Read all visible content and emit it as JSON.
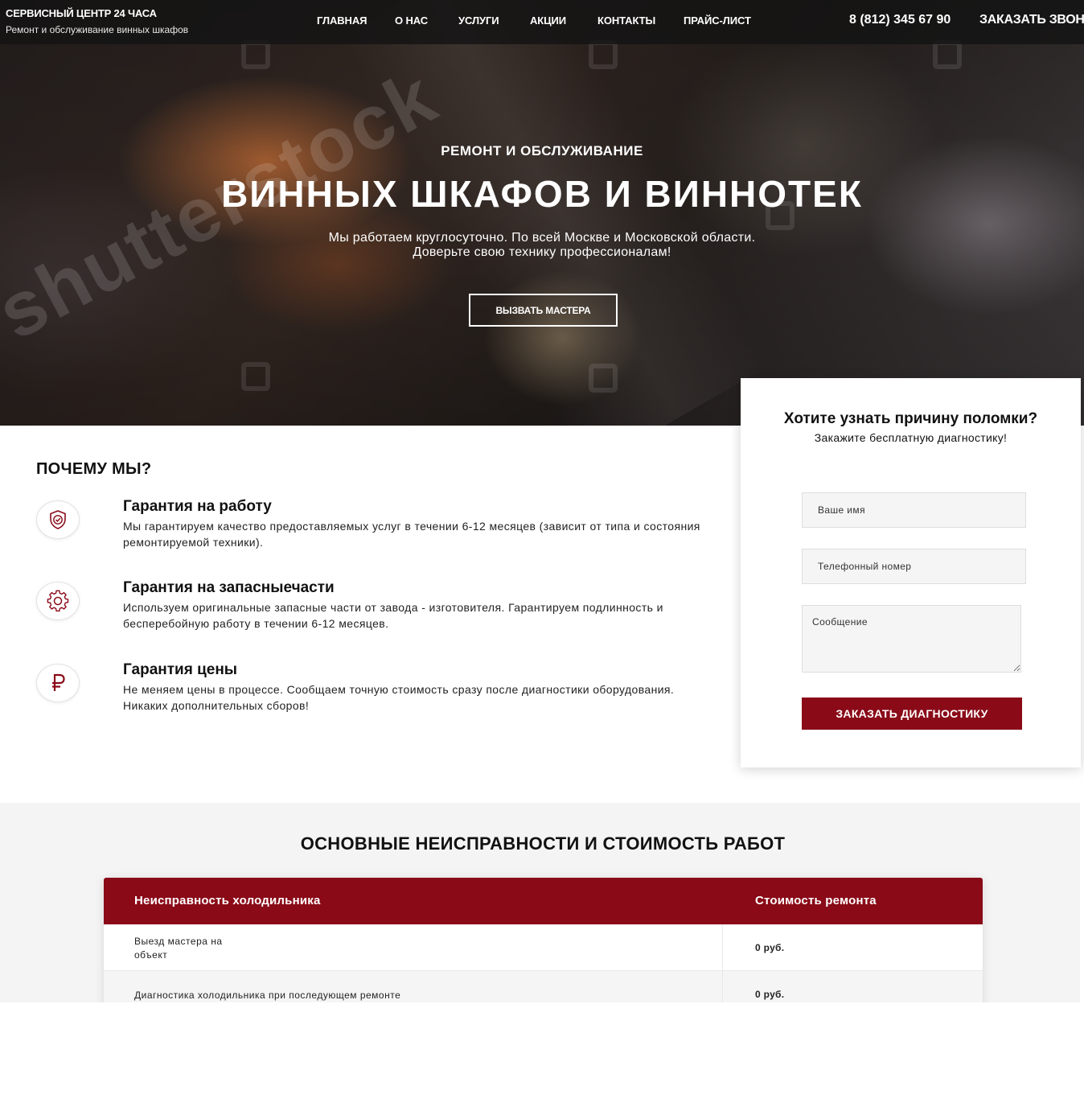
{
  "header": {
    "brand_title": "СЕРВИСНЫЙ ЦЕНТР 24 ЧАСА",
    "brand_subtitle": "Ремонт и обслуживание винных шкафов",
    "nav": [
      "ГЛАВНАЯ",
      "О НАС",
      "УСЛУГИ",
      "АКЦИИ",
      "КОНТАКТЫ",
      "ПРАЙС-ЛИСТ"
    ],
    "phone": "8 (812) 345 67 90",
    "callback": "ЗАКАЗАТЬ ЗВОНОК"
  },
  "hero": {
    "kicker": "РЕМОНТ И ОБСЛУЖИВАНИЕ",
    "title": "ВИННЫХ ШКАФОВ И ВИННОТЕК",
    "desc_line1": "Мы работаем круглосуточно. По всей Москве и Московской области.",
    "desc_line2": "Доверьте свою технику профессионалам!",
    "button": "ВЫЗВАТЬ МАСТЕРА",
    "watermark": "shutterstock"
  },
  "why": {
    "title": "ПОЧЕМУ МЫ?",
    "features": [
      {
        "icon": "shield-check-icon",
        "title": "Гарантия на работу",
        "text": "Мы гарантируем качество предоставляемых услуг в течении 6-12 месяцев (зависит от типа и состояния ремонтируемой техники)."
      },
      {
        "icon": "gear-icon",
        "title": "Гарантия на запасныечасти",
        "text": "Используем оригинальные запасные части от завода - изготовителя. Гарантируем подлинность и бесперебойную работу в течении 6-12 месяцев."
      },
      {
        "icon": "ruble-icon",
        "title": "Гарантия цены",
        "text": "Не меняем цены в процессе. Сообщаем точную стоимость сразу после диагностики оборудования. Никаких дополнительных сборов!"
      }
    ]
  },
  "form": {
    "title": "Хотите узнать причину поломки?",
    "subtitle": "Закажите бесплатную диагностику!",
    "name_placeholder": "Ваше имя",
    "phone_placeholder": "Телефонный номер",
    "message_placeholder": "Сообщение",
    "submit": "ЗАКАЗАТЬ ДИАГНОСТИКУ"
  },
  "prices": {
    "title": "ОСНОВНЫЕ НЕИСПРАВНОСТИ И СТОИМОСТЬ РАБОТ",
    "col_problem": "Неисправность холодильника",
    "col_cost": "Стоимость ремонта",
    "rows": [
      {
        "line1": "Выезд мастера на",
        "line2": "объект",
        "price": "0 руб."
      },
      {
        "line1": "Диагностика холодильника при последующем ремонте",
        "line2": "",
        "price": "0 руб."
      }
    ]
  },
  "colors": {
    "accent": "#8a0a18",
    "header_bg": "#141414",
    "section_bg": "#f5f4f4"
  }
}
